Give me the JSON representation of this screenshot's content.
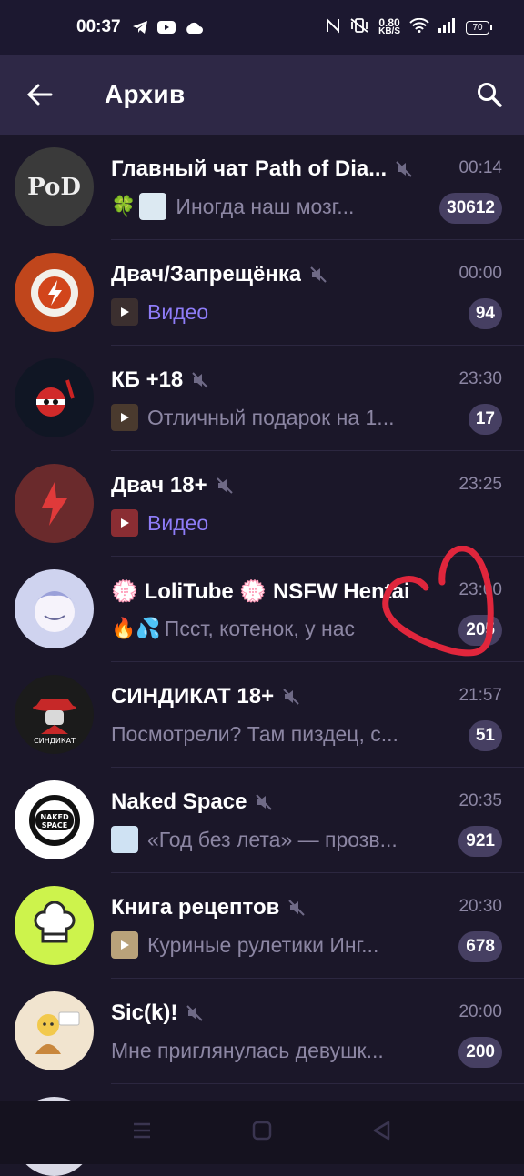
{
  "status_bar": {
    "time": "00:37",
    "speed_value": "0.80",
    "speed_unit": "KB/S",
    "battery": "70"
  },
  "appbar": {
    "title": "Архив"
  },
  "chats": [
    {
      "title": "Главный чат Path of Dia...",
      "time": "00:14",
      "preview": "Иногда наш мозг...",
      "badge": "30612",
      "emoji": "🍀",
      "media": false,
      "muted": true,
      "avatar_text": "PoD",
      "avatar_bg": "#3a3a3a"
    },
    {
      "title": "Двач/Запрещёнка",
      "time": "00:00",
      "preview": "Видео",
      "badge": "94",
      "emoji": "",
      "media": true,
      "muted": true,
      "avatar_text": "",
      "avatar_bg": "#c0461c"
    },
    {
      "title": "КБ +18",
      "time": "23:30",
      "preview": "Отличный подарок на 1...",
      "badge": "17",
      "emoji": "",
      "media": false,
      "muted": true,
      "avatar_text": "",
      "avatar_bg": "#101624"
    },
    {
      "title": "Двач 18+",
      "time": "23:25",
      "preview": "Видео",
      "badge": "",
      "emoji": "",
      "media": true,
      "muted": true,
      "avatar_text": "",
      "avatar_bg": "#6a2a2c"
    },
    {
      "title": "💮 LoliTube 💮 NSFW Hentai",
      "time": "23:00",
      "preview": "Псст, котенок, у нас",
      "badge": "205",
      "emoji": "🔥💦",
      "media": false,
      "muted": false,
      "avatar_text": "",
      "avatar_bg": "#cfd3ef"
    },
    {
      "title": "СИНДИКАТ 18+",
      "time": "21:57",
      "preview": "Посмотрели? Там пиздец, с...",
      "badge": "51",
      "emoji": "",
      "media": false,
      "muted": true,
      "avatar_text": "СИНДИКАТ",
      "avatar_bg": "#1b1b1b"
    },
    {
      "title": "Naked Space",
      "time": "20:35",
      "preview": "«Год без лета» — прозв...",
      "badge": "921",
      "emoji": "",
      "media": false,
      "muted": true,
      "avatar_text": "NAKED SPACE",
      "avatar_bg": "#ffffff"
    },
    {
      "title": "Книга рецептов",
      "time": "20:30",
      "preview": "Куриные рулетики Инг...",
      "badge": "678",
      "emoji": "",
      "media": false,
      "muted": true,
      "avatar_text": "",
      "avatar_bg": "#cdf34c"
    },
    {
      "title": "Sic(k)!",
      "time": "20:00",
      "preview": "Мне приглянулась девушк...",
      "badge": "200",
      "emoji": "",
      "media": false,
      "muted": true,
      "avatar_text": "",
      "avatar_bg": "#f1e4cf"
    }
  ],
  "colors": {
    "background": "#1b1729",
    "appbar": "#2e2846",
    "muted_text": "#8c86a3",
    "accent": "#8e7cf7",
    "badge": "#463f62",
    "annotation": "#e0263c"
  }
}
